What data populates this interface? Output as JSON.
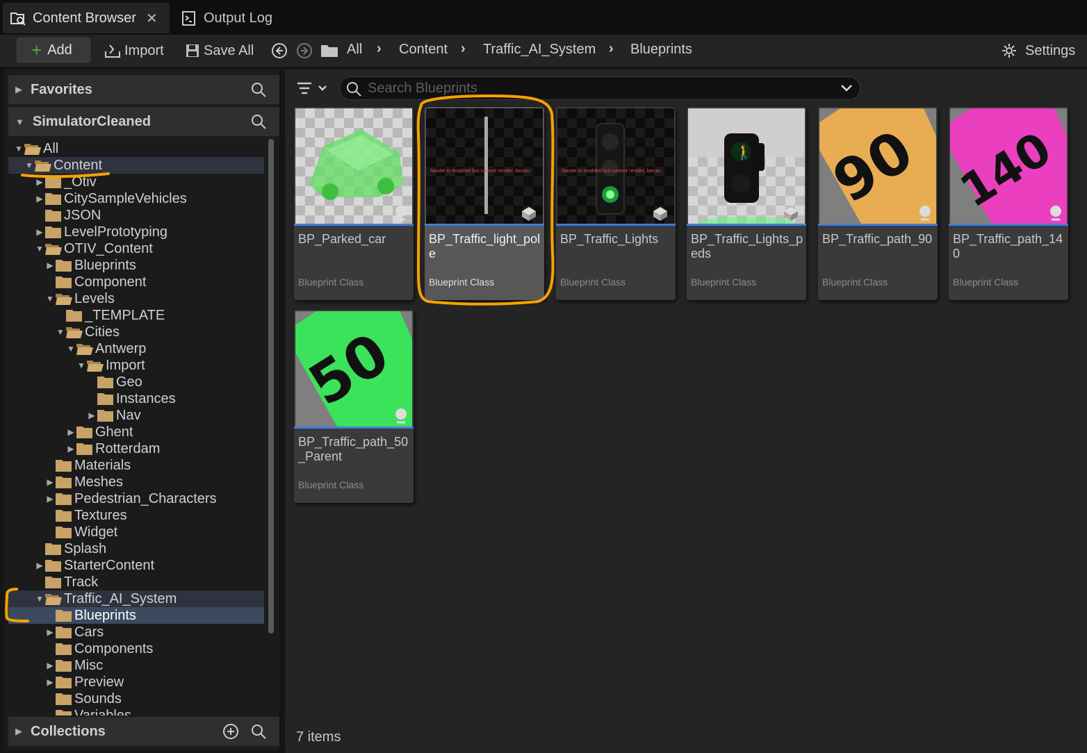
{
  "tabs": [
    {
      "label": "Content Browser",
      "icon": "content-browser-icon",
      "active": true
    },
    {
      "label": "Output Log",
      "icon": "output-log-icon",
      "active": false
    }
  ],
  "toolbar": {
    "add_label": "Add",
    "import_label": "Import",
    "save_all_label": "Save All",
    "settings_label": "Settings"
  },
  "breadcrumb": [
    "All",
    "Content",
    "Traffic_AI_System",
    "Blueprints"
  ],
  "left_panel": {
    "favorites_label": "Favorites",
    "project_label": "SimulatorCleaned",
    "collections_label": "Collections"
  },
  "tree": [
    {
      "label": "All",
      "depth": 0,
      "arrow": "down",
      "open": true
    },
    {
      "label": "Content",
      "depth": 1,
      "arrow": "down",
      "open": true,
      "highlight": true
    },
    {
      "label": "_Otiv",
      "depth": 2,
      "arrow": "right"
    },
    {
      "label": "CitySampleVehicles",
      "depth": 2,
      "arrow": "right"
    },
    {
      "label": "JSON",
      "depth": 2,
      "arrow": ""
    },
    {
      "label": "LevelPrototyping",
      "depth": 2,
      "arrow": "right"
    },
    {
      "label": "OTIV_Content",
      "depth": 2,
      "arrow": "down",
      "open": true
    },
    {
      "label": "Blueprints",
      "depth": 3,
      "arrow": "right"
    },
    {
      "label": "Component",
      "depth": 3,
      "arrow": ""
    },
    {
      "label": "Levels",
      "depth": 3,
      "arrow": "down",
      "open": true
    },
    {
      "label": "_TEMPLATE",
      "depth": 4,
      "arrow": ""
    },
    {
      "label": "Cities",
      "depth": 4,
      "arrow": "down",
      "open": true
    },
    {
      "label": "Antwerp",
      "depth": 5,
      "arrow": "down",
      "open": true
    },
    {
      "label": "Import",
      "depth": 6,
      "arrow": "down",
      "open": true
    },
    {
      "label": "Geo",
      "depth": 7,
      "arrow": ""
    },
    {
      "label": "Instances",
      "depth": 7,
      "arrow": ""
    },
    {
      "label": "Nav",
      "depth": 7,
      "arrow": "right"
    },
    {
      "label": "Ghent",
      "depth": 5,
      "arrow": "right"
    },
    {
      "label": "Rotterdam",
      "depth": 5,
      "arrow": "right"
    },
    {
      "label": "Materials",
      "depth": 3,
      "arrow": ""
    },
    {
      "label": "Meshes",
      "depth": 3,
      "arrow": "right"
    },
    {
      "label": "Pedestrian_Characters",
      "depth": 3,
      "arrow": "right"
    },
    {
      "label": "Textures",
      "depth": 3,
      "arrow": ""
    },
    {
      "label": "Widget",
      "depth": 3,
      "arrow": ""
    },
    {
      "label": "Splash",
      "depth": 2,
      "arrow": ""
    },
    {
      "label": "StarterContent",
      "depth": 2,
      "arrow": "right"
    },
    {
      "label": "Track",
      "depth": 2,
      "arrow": ""
    },
    {
      "label": "Traffic_AI_System",
      "depth": 2,
      "arrow": "down",
      "open": true,
      "highlight": true
    },
    {
      "label": "Blueprints",
      "depth": 3,
      "arrow": "",
      "selected": true
    },
    {
      "label": "Cars",
      "depth": 3,
      "arrow": "right"
    },
    {
      "label": "Components",
      "depth": 3,
      "arrow": ""
    },
    {
      "label": "Misc",
      "depth": 3,
      "arrow": "right"
    },
    {
      "label": "Preview",
      "depth": 3,
      "arrow": "right"
    },
    {
      "label": "Sounds",
      "depth": 3,
      "arrow": ""
    },
    {
      "label": "Variables",
      "depth": 3,
      "arrow": ""
    }
  ],
  "search": {
    "placeholder": "Search Blueprints",
    "value": ""
  },
  "assets": [
    {
      "name": "BP_Parked_car",
      "type": "Blueprint Class",
      "thumb": "parked-car",
      "selected": false
    },
    {
      "name": "BP_Traffic_light_pole",
      "type": "Blueprint Class",
      "thumb": "light-pole",
      "selected": true,
      "overlay_text": "Nanite is enabled but cannot render, becau"
    },
    {
      "name": "BP_Traffic_Lights",
      "type": "Blueprint Class",
      "thumb": "traffic-lights",
      "selected": false,
      "overlay_text": "Nanite is enabled but cannot render, becau"
    },
    {
      "name": "BP_Traffic_Lights_peds",
      "type": "Blueprint Class",
      "thumb": "traffic-lights-peds",
      "selected": false
    },
    {
      "name": "BP_Traffic_path_90",
      "type": "Blueprint Class",
      "thumb": "path-90",
      "selected": false,
      "sign_text": "90"
    },
    {
      "name": "BP_Traffic_path_140",
      "type": "Blueprint Class",
      "thumb": "path-140",
      "selected": false,
      "sign_text": "140"
    },
    {
      "name": "BP_Traffic_path_50_Parent",
      "type": "Blueprint Class",
      "thumb": "path-50",
      "selected": false,
      "sign_text": "50"
    }
  ],
  "status": {
    "items_count": "7 items"
  },
  "colors": {
    "accent": "#3e7be0",
    "folder": "#c8a266",
    "annotation": "#f5a300",
    "add_plus": "#4caf32"
  }
}
